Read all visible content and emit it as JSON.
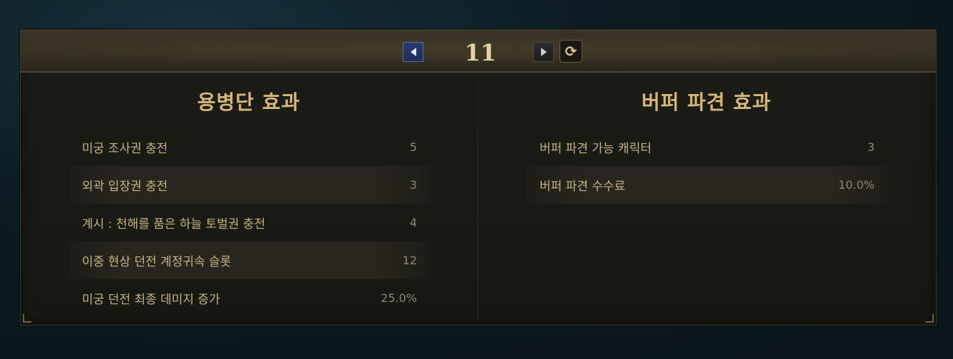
{
  "pager": {
    "prev_icon": "triangle-left-icon",
    "next_icon": "triangle-right-icon",
    "refresh_icon": "refresh-icon",
    "page": "11"
  },
  "left_section": {
    "title": "용병단 효과",
    "rows": [
      {
        "label": "미궁 조사권 충전",
        "value": "5"
      },
      {
        "label": "외곽 입장권 충전",
        "value": "3"
      },
      {
        "label": "계시 : 천해를 품은 하늘 토벌권 충전",
        "value": "4"
      },
      {
        "label": "이중 현상 던전 계정귀속 슬롯",
        "value": "12"
      },
      {
        "label": "미궁 던전 최종 데미지 증가",
        "value": "25.0%"
      }
    ]
  },
  "right_section": {
    "title": "버퍼 파견 효과",
    "rows": [
      {
        "label": "버퍼 파견 가능 캐릭터",
        "value": "3"
      },
      {
        "label": "버퍼 파견 수수료",
        "value": "10.0%"
      }
    ]
  },
  "colors": {
    "title_gold": "#d4b67a",
    "label_gold": "#c4b486",
    "value_gray": "#8d8672",
    "prev_button_blue": "#2a3a6e"
  }
}
